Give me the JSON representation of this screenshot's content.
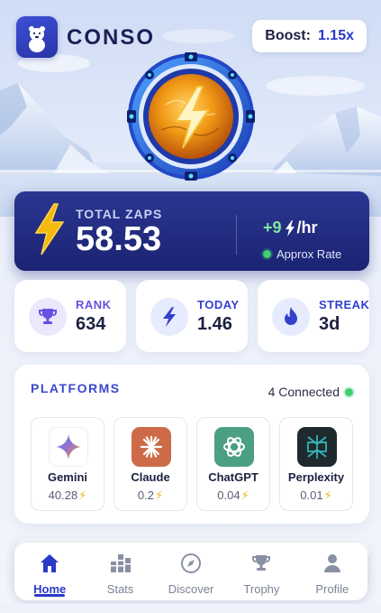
{
  "app": {
    "name": "CONSO",
    "logo_icon": "polar-bear-icon"
  },
  "boost": {
    "label": "Boost:",
    "value": "1.15x"
  },
  "zaps": {
    "label": "TOTAL ZAPS",
    "value": "58.53",
    "rate_value": "+9",
    "rate_unit": "/hr",
    "rate_label": "Approx Rate"
  },
  "stats": [
    {
      "label": "RANK",
      "value": "634",
      "icon": "trophy-icon"
    },
    {
      "label": "TODAY",
      "value": "1.46",
      "icon": "bolt-icon"
    },
    {
      "label": "STREAK",
      "value": "3d",
      "icon": "flame-icon"
    }
  ],
  "platforms": {
    "title": "PLATFORMS",
    "connected_label": "4 Connected",
    "items": [
      {
        "name": "Gemini",
        "amount": "40.28",
        "icon": "gemini-icon"
      },
      {
        "name": "Claude",
        "amount": "0.2",
        "icon": "claude-icon"
      },
      {
        "name": "ChatGPT",
        "amount": "0.04",
        "icon": "chatgpt-icon"
      },
      {
        "name": "Perplexity",
        "amount": "0.01",
        "icon": "perplexity-icon"
      }
    ]
  },
  "nav": {
    "items": [
      {
        "label": "Home",
        "icon": "home-icon",
        "active": true
      },
      {
        "label": "Stats",
        "icon": "stats-icon",
        "active": false
      },
      {
        "label": "Discover",
        "icon": "compass-icon",
        "active": false
      },
      {
        "label": "Trophy",
        "icon": "trophy-icon",
        "active": false
      },
      {
        "label": "Profile",
        "icon": "profile-icon",
        "active": false
      }
    ]
  },
  "colors": {
    "accent": "#2b39c9",
    "zaps_card": "#1f2878",
    "rate_green": "#7ee6a2",
    "bolt_yellow": "#f5b90f"
  }
}
